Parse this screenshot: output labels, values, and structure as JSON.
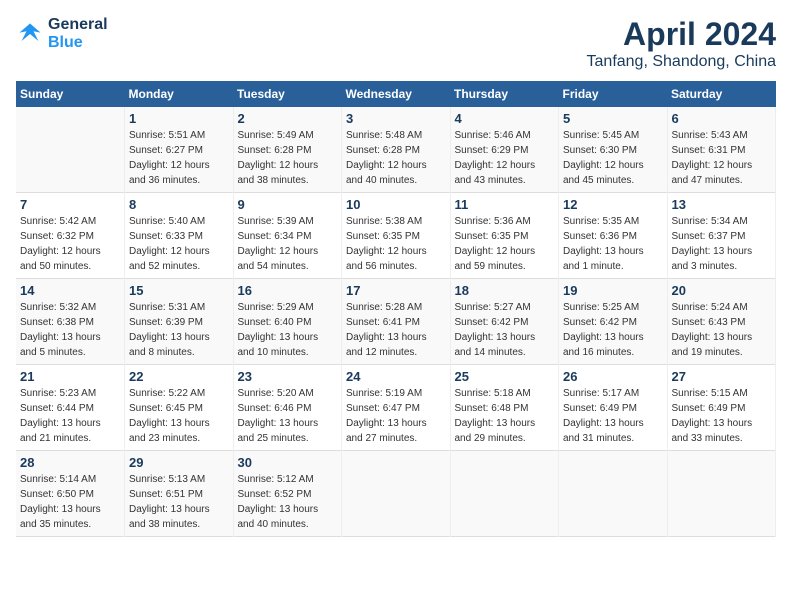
{
  "header": {
    "logo_line1": "General",
    "logo_line2": "Blue",
    "title": "April 2024",
    "subtitle": "Tanfang, Shandong, China"
  },
  "calendar": {
    "days_of_week": [
      "Sunday",
      "Monday",
      "Tuesday",
      "Wednesday",
      "Thursday",
      "Friday",
      "Saturday"
    ],
    "weeks": [
      [
        {
          "day": "",
          "info": ""
        },
        {
          "day": "1",
          "info": "Sunrise: 5:51 AM\nSunset: 6:27 PM\nDaylight: 12 hours\nand 36 minutes."
        },
        {
          "day": "2",
          "info": "Sunrise: 5:49 AM\nSunset: 6:28 PM\nDaylight: 12 hours\nand 38 minutes."
        },
        {
          "day": "3",
          "info": "Sunrise: 5:48 AM\nSunset: 6:28 PM\nDaylight: 12 hours\nand 40 minutes."
        },
        {
          "day": "4",
          "info": "Sunrise: 5:46 AM\nSunset: 6:29 PM\nDaylight: 12 hours\nand 43 minutes."
        },
        {
          "day": "5",
          "info": "Sunrise: 5:45 AM\nSunset: 6:30 PM\nDaylight: 12 hours\nand 45 minutes."
        },
        {
          "day": "6",
          "info": "Sunrise: 5:43 AM\nSunset: 6:31 PM\nDaylight: 12 hours\nand 47 minutes."
        }
      ],
      [
        {
          "day": "7",
          "info": "Sunrise: 5:42 AM\nSunset: 6:32 PM\nDaylight: 12 hours\nand 50 minutes."
        },
        {
          "day": "8",
          "info": "Sunrise: 5:40 AM\nSunset: 6:33 PM\nDaylight: 12 hours\nand 52 minutes."
        },
        {
          "day": "9",
          "info": "Sunrise: 5:39 AM\nSunset: 6:34 PM\nDaylight: 12 hours\nand 54 minutes."
        },
        {
          "day": "10",
          "info": "Sunrise: 5:38 AM\nSunset: 6:35 PM\nDaylight: 12 hours\nand 56 minutes."
        },
        {
          "day": "11",
          "info": "Sunrise: 5:36 AM\nSunset: 6:35 PM\nDaylight: 12 hours\nand 59 minutes."
        },
        {
          "day": "12",
          "info": "Sunrise: 5:35 AM\nSunset: 6:36 PM\nDaylight: 13 hours\nand 1 minute."
        },
        {
          "day": "13",
          "info": "Sunrise: 5:34 AM\nSunset: 6:37 PM\nDaylight: 13 hours\nand 3 minutes."
        }
      ],
      [
        {
          "day": "14",
          "info": "Sunrise: 5:32 AM\nSunset: 6:38 PM\nDaylight: 13 hours\nand 5 minutes."
        },
        {
          "day": "15",
          "info": "Sunrise: 5:31 AM\nSunset: 6:39 PM\nDaylight: 13 hours\nand 8 minutes."
        },
        {
          "day": "16",
          "info": "Sunrise: 5:29 AM\nSunset: 6:40 PM\nDaylight: 13 hours\nand 10 minutes."
        },
        {
          "day": "17",
          "info": "Sunrise: 5:28 AM\nSunset: 6:41 PM\nDaylight: 13 hours\nand 12 minutes."
        },
        {
          "day": "18",
          "info": "Sunrise: 5:27 AM\nSunset: 6:42 PM\nDaylight: 13 hours\nand 14 minutes."
        },
        {
          "day": "19",
          "info": "Sunrise: 5:25 AM\nSunset: 6:42 PM\nDaylight: 13 hours\nand 16 minutes."
        },
        {
          "day": "20",
          "info": "Sunrise: 5:24 AM\nSunset: 6:43 PM\nDaylight: 13 hours\nand 19 minutes."
        }
      ],
      [
        {
          "day": "21",
          "info": "Sunrise: 5:23 AM\nSunset: 6:44 PM\nDaylight: 13 hours\nand 21 minutes."
        },
        {
          "day": "22",
          "info": "Sunrise: 5:22 AM\nSunset: 6:45 PM\nDaylight: 13 hours\nand 23 minutes."
        },
        {
          "day": "23",
          "info": "Sunrise: 5:20 AM\nSunset: 6:46 PM\nDaylight: 13 hours\nand 25 minutes."
        },
        {
          "day": "24",
          "info": "Sunrise: 5:19 AM\nSunset: 6:47 PM\nDaylight: 13 hours\nand 27 minutes."
        },
        {
          "day": "25",
          "info": "Sunrise: 5:18 AM\nSunset: 6:48 PM\nDaylight: 13 hours\nand 29 minutes."
        },
        {
          "day": "26",
          "info": "Sunrise: 5:17 AM\nSunset: 6:49 PM\nDaylight: 13 hours\nand 31 minutes."
        },
        {
          "day": "27",
          "info": "Sunrise: 5:15 AM\nSunset: 6:49 PM\nDaylight: 13 hours\nand 33 minutes."
        }
      ],
      [
        {
          "day": "28",
          "info": "Sunrise: 5:14 AM\nSunset: 6:50 PM\nDaylight: 13 hours\nand 35 minutes."
        },
        {
          "day": "29",
          "info": "Sunrise: 5:13 AM\nSunset: 6:51 PM\nDaylight: 13 hours\nand 38 minutes."
        },
        {
          "day": "30",
          "info": "Sunrise: 5:12 AM\nSunset: 6:52 PM\nDaylight: 13 hours\nand 40 minutes."
        },
        {
          "day": "",
          "info": ""
        },
        {
          "day": "",
          "info": ""
        },
        {
          "day": "",
          "info": ""
        },
        {
          "day": "",
          "info": ""
        }
      ]
    ]
  }
}
